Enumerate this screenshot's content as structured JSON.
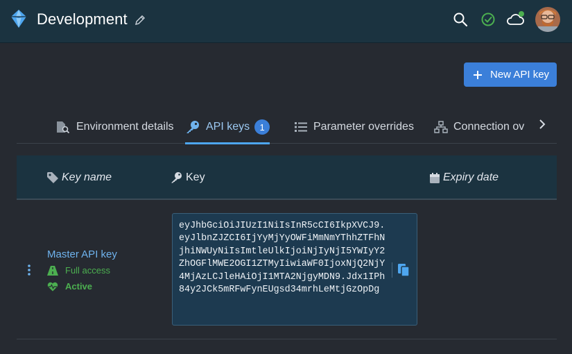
{
  "header": {
    "title": "Development",
    "logo_icon": "diamond-logo-icon",
    "icons": [
      "search-icon",
      "check-circle-icon",
      "cloud-icon"
    ],
    "status_color": "#4caf50"
  },
  "actions": {
    "new_api_key_label": "New API key"
  },
  "tabs": [
    {
      "label": "Environment details",
      "icon": "document-search-icon"
    },
    {
      "label": "API keys",
      "icon": "key-icon",
      "badge": "1",
      "active": true
    },
    {
      "label": "Parameter overrides",
      "icon": "list-icon"
    },
    {
      "label": "Connection ov",
      "icon": "network-icon"
    }
  ],
  "table": {
    "columns": [
      {
        "label": "Key name",
        "icon": "tag-icon"
      },
      {
        "label": "Key",
        "icon": "key-icon"
      },
      {
        "label": "Expiry date",
        "icon": "calendar-icon"
      }
    ],
    "rows": [
      {
        "name": "Master API key",
        "access": "Full access",
        "status": "Active",
        "key": "eyJhbGciOiJIUzI1NiIsInR5cCI6IkpXVCJ9.eyJlbnZJZCI6IjYyMjYyOWFiMmNmYThhZTFhNjhiNWUyNiIsImtleUlkIjoiNjIyNjI5YWIyY2ZhOGFlMWE2OGI1ZTMyIiwiaWF0IjoxNjQ2NjY4MjAzLCJleHAiOjI1MTA2NjgyMDN9.Jdx1IPh84y2JCk5mRFwFynEUgsd34mrhLeMtjGzOpDg",
        "expiry": ""
      }
    ]
  },
  "colors": {
    "accent": "#3b7fd9",
    "link": "#6fb3ee",
    "success": "#4caf50",
    "header_bg": "#1b3340",
    "page_bg": "#262a31"
  }
}
